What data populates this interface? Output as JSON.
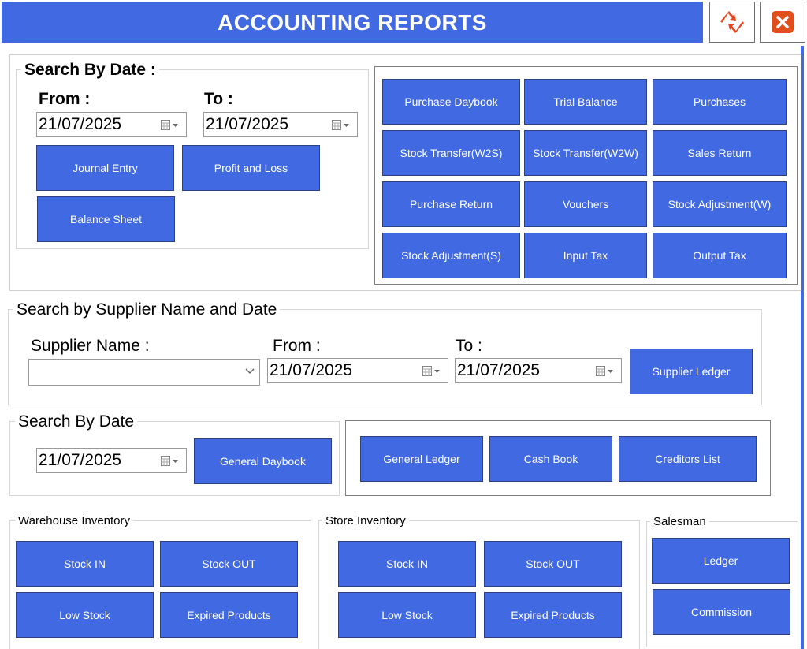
{
  "header": {
    "title": "ACCOUNTING REPORTS"
  },
  "icons": {
    "refresh": "refresh-arrows-icon",
    "close": "close-x-icon"
  },
  "colors": {
    "primary": "#4169e1",
    "refresh": "#e8431a",
    "close": "#e24d1c"
  },
  "search_by_date": {
    "legend": "Search By Date :",
    "from_label": "From :",
    "to_label": "To :",
    "from_value": "21/07/2025",
    "to_value": "21/07/2025",
    "buttons": [
      "Journal Entry",
      "Profit and Loss",
      "Balance Sheet"
    ]
  },
  "report_grid": {
    "buttons": [
      "Purchase Daybook",
      "Trial Balance",
      "Purchases",
      "Stock Transfer(W2S)",
      "Stock Transfer(W2W)",
      "Sales Return",
      "Purchase Return",
      "Vouchers",
      "Stock Adjustment(W)",
      "Stock Adjustment(S)",
      "Input Tax",
      "Output Tax"
    ]
  },
  "supplier_search": {
    "legend": "Search by Supplier Name and Date",
    "supplier_label": "Supplier Name :",
    "supplier_value": "",
    "from_label": "From :",
    "to_label": "To :",
    "from_value": "21/07/2025",
    "to_value": "21/07/2025",
    "button": "Supplier Ledger"
  },
  "daybook_search": {
    "legend": "Search By Date",
    "date_value": "21/07/2025",
    "button": "General Daybook"
  },
  "ledger_group": {
    "buttons": [
      "General Ledger",
      "Cash Book",
      "Creditors List"
    ]
  },
  "warehouse_inventory": {
    "legend": "Warehouse Inventory",
    "buttons": [
      "Stock IN",
      "Stock OUT",
      "Low Stock",
      "Expired Products"
    ]
  },
  "store_inventory": {
    "legend": "Store Inventory",
    "buttons": [
      "Stock IN",
      "Stock OUT",
      "Low Stock",
      "Expired Products"
    ]
  },
  "salesman": {
    "legend": "Salesman",
    "buttons": [
      "Ledger",
      "Commission"
    ]
  }
}
